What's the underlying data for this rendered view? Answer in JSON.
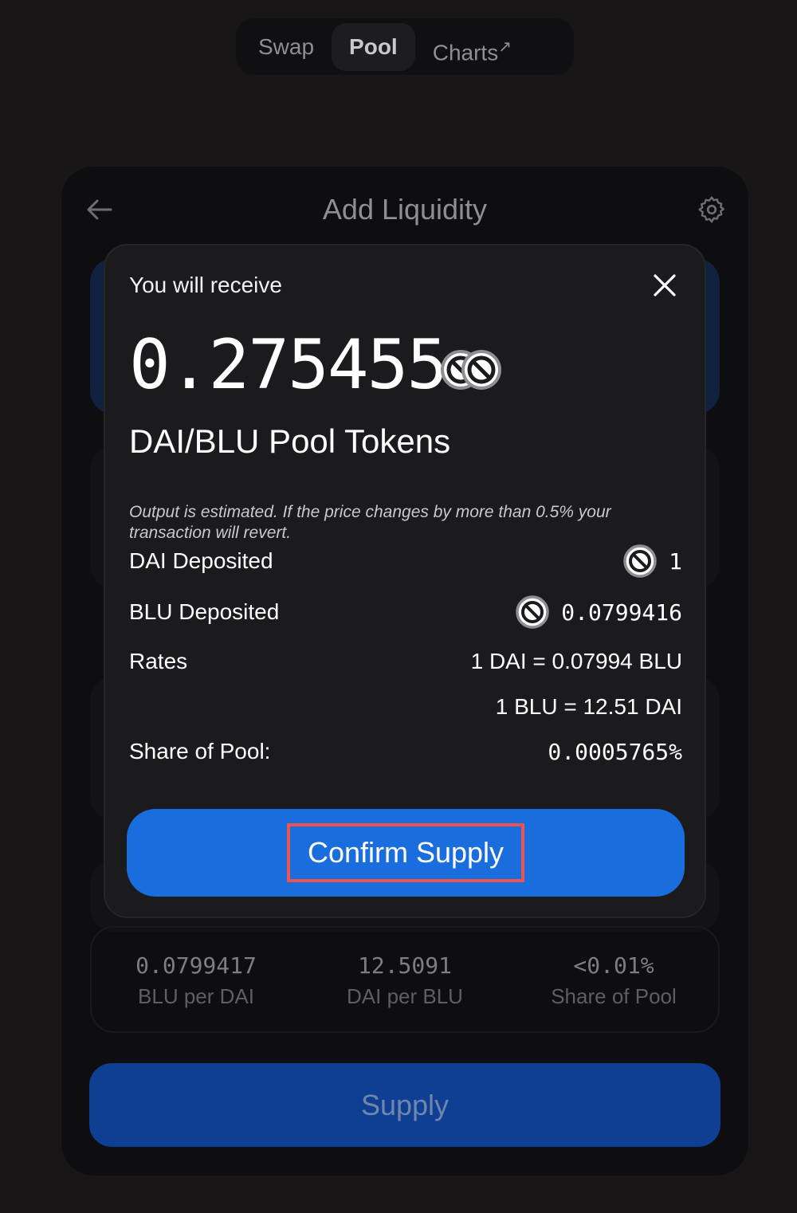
{
  "nav": {
    "tabs": [
      {
        "label": "Swap"
      },
      {
        "label": "Pool"
      },
      {
        "label": "Charts"
      }
    ],
    "external_arrow": "↗"
  },
  "card": {
    "title": "Add Liquidity",
    "prices": [
      {
        "value": "0.0799417",
        "label": "BLU per DAI"
      },
      {
        "value": "12.5091",
        "label": "DAI per BLU"
      },
      {
        "value": "<0.01%",
        "label": "Share of Pool"
      }
    ],
    "supply_label": "Supply"
  },
  "modal": {
    "receive_label": "You will receive",
    "amount": "0.275455",
    "pool_tokens_label": "DAI/BLU Pool Tokens",
    "estimate_note": "Output is estimated. If the price changes by more than 0.5% your transaction will revert.",
    "dai_deposited_label": "DAI Deposited",
    "dai_deposited_value": "1",
    "blu_deposited_label": "BLU Deposited",
    "blu_deposited_value": "0.0799416",
    "rates_label": "Rates",
    "rate_1": "1 DAI = 0.07994 BLU",
    "rate_2": "1 BLU = 12.51 DAI",
    "share_label": "Share of Pool:",
    "share_value": "0.0005765%",
    "confirm_label": "Confirm Supply"
  },
  "colors": {
    "background": "#191618",
    "accent": "#1a6ddc",
    "highlight": "#ef5350"
  },
  "icons": [
    "back-arrow-icon",
    "gear-icon",
    "close-icon",
    "token-placeholder-icon",
    "external-link-icon"
  ]
}
